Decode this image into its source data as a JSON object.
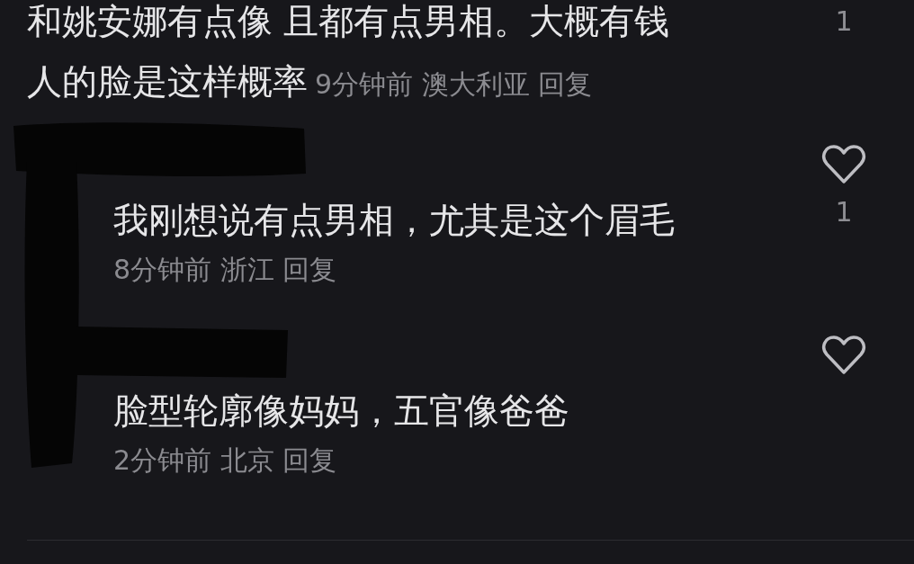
{
  "comments": [
    {
      "kind": "comment",
      "text_lines": [
        "和姚安娜有点像 且都有点男相。大概有钱",
        "人的脸是这样概率"
      ],
      "time": "9分钟前",
      "location": "澳大利亚",
      "reply": "回复",
      "likes": "1"
    },
    {
      "kind": "reply",
      "text_lines": [
        "我刚想说有点男相，尤其是这个眉毛"
      ],
      "time": "8分钟前",
      "location": "浙江",
      "reply": "回复",
      "likes": "1"
    },
    {
      "kind": "reply",
      "text_lines": [
        "脸型轮廓像妈妈，五官像爸爸"
      ],
      "time": "2分钟前",
      "location": "北京",
      "reply": "回复"
    }
  ]
}
